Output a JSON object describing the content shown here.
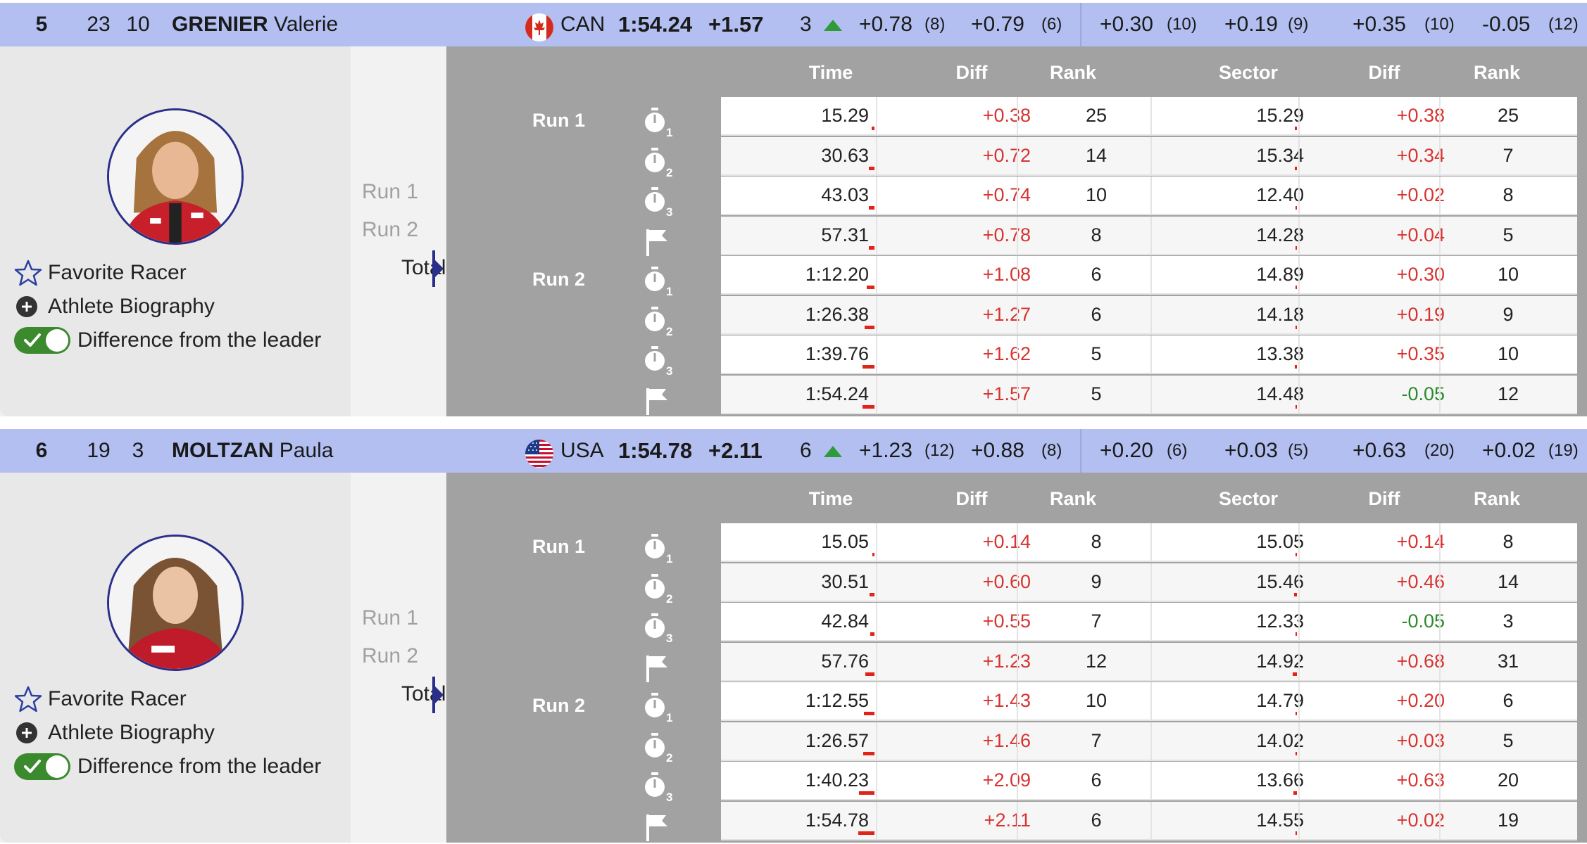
{
  "labels": {
    "favorite": "Favorite Racer",
    "biography": "Athlete Biography",
    "diff_leader": "Difference from the leader",
    "run1": "Run 1",
    "run2": "Run 2",
    "total": "Total",
    "col_time": "Time",
    "col_diff": "Diff",
    "col_rank": "Rank",
    "col_sector": "Sector",
    "col_diff2": "Diff",
    "col_rank2": "Rank"
  },
  "colors": {
    "header_bg": "#b2bff0",
    "accent": "#2a2f8a",
    "negative": "#d7332f",
    "positive": "#2b8a2b",
    "toggle_on": "#3c8a2e"
  },
  "racers": [
    {
      "pos": "5",
      "bib": "23",
      "start": "10",
      "last_name": "GRENIER",
      "first_name": "Valerie",
      "nation": "CAN",
      "flag": "canada-flag-icon",
      "time": "1:54.24",
      "diff": "+1.57",
      "rank_change": "3",
      "splits": [
        {
          "v": "+0.78",
          "p": "(8)"
        },
        {
          "v": "+0.79",
          "p": "(6)"
        },
        {
          "v": "+0.30",
          "p": "(10)"
        },
        {
          "v": "+0.19",
          "p": "(9)"
        },
        {
          "v": "+0.35",
          "p": "(10)"
        },
        {
          "v": "-0.05",
          "p": "(12)"
        }
      ],
      "rows": [
        {
          "time": "15.29",
          "diff": "+0.38",
          "rank": "25",
          "sector": "15.29",
          "sdiff": "+0.38",
          "srank": "25",
          "bar": 0.07,
          "sbar": 0.05
        },
        {
          "time": "30.63",
          "diff": "+0.72",
          "rank": "14",
          "sector": "15.34",
          "sdiff": "+0.34",
          "srank": "7",
          "bar": 0.13,
          "sbar": 0.05
        },
        {
          "time": "43.03",
          "diff": "+0.74",
          "rank": "10",
          "sector": "12.40",
          "sdiff": "+0.02",
          "srank": "8",
          "bar": 0.13,
          "sbar": 0.01
        },
        {
          "time": "57.31",
          "diff": "+0.78",
          "rank": "8",
          "sector": "14.28",
          "sdiff": "+0.04",
          "srank": "5",
          "bar": 0.14,
          "sbar": 0.01
        },
        {
          "time": "1:12.20",
          "diff": "+1.08",
          "rank": "6",
          "sector": "14.89",
          "sdiff": "+0.30",
          "srank": "10",
          "bar": 0.19,
          "sbar": 0.04
        },
        {
          "time": "1:26.38",
          "diff": "+1.27",
          "rank": "6",
          "sector": "14.18",
          "sdiff": "+0.19",
          "srank": "9",
          "bar": 0.23,
          "sbar": 0.03
        },
        {
          "time": "1:39.76",
          "diff": "+1.62",
          "rank": "5",
          "sector": "13.38",
          "sdiff": "+0.35",
          "srank": "10",
          "bar": 0.29,
          "sbar": 0.05
        },
        {
          "time": "1:54.24",
          "diff": "+1.57",
          "rank": "5",
          "sector": "14.48",
          "sdiff": "-0.05",
          "srank": "12",
          "bar": 0.28,
          "sbar": 0.01,
          "sgreen": true
        }
      ]
    },
    {
      "pos": "6",
      "bib": "19",
      "start": "3",
      "last_name": "MOLTZAN",
      "first_name": "Paula",
      "nation": "USA",
      "flag": "usa-flag-icon",
      "time": "1:54.78",
      "diff": "+2.11",
      "rank_change": "6",
      "splits": [
        {
          "v": "+1.23",
          "p": "(12)"
        },
        {
          "v": "+0.88",
          "p": "(8)"
        },
        {
          "v": "+0.20",
          "p": "(6)"
        },
        {
          "v": "+0.03",
          "p": "(5)"
        },
        {
          "v": "+0.63",
          "p": "(20)"
        },
        {
          "v": "+0.02",
          "p": "(19)"
        }
      ],
      "rows": [
        {
          "time": "15.05",
          "diff": "+0.14",
          "rank": "8",
          "sector": "15.05",
          "sdiff": "+0.14",
          "srank": "8",
          "bar": 0.03,
          "sbar": 0.02
        },
        {
          "time": "30.51",
          "diff": "+0.60",
          "rank": "9",
          "sector": "15.46",
          "sdiff": "+0.46",
          "srank": "14",
          "bar": 0.11,
          "sbar": 0.07
        },
        {
          "time": "42.84",
          "diff": "+0.55",
          "rank": "7",
          "sector": "12.33",
          "sdiff": "-0.05",
          "srank": "3",
          "bar": 0.1,
          "sbar": 0.01,
          "sgreen": true
        },
        {
          "time": "57.76",
          "diff": "+1.23",
          "rank": "12",
          "sector": "14.92",
          "sdiff": "+0.68",
          "srank": "31",
          "bar": 0.22,
          "sbar": 0.1
        },
        {
          "time": "1:12.55",
          "diff": "+1.43",
          "rank": "10",
          "sector": "14.79",
          "sdiff": "+0.20",
          "srank": "6",
          "bar": 0.25,
          "sbar": 0.03
        },
        {
          "time": "1:26.57",
          "diff": "+1.46",
          "rank": "7",
          "sector": "14.02",
          "sdiff": "+0.03",
          "srank": "5",
          "bar": 0.26,
          "sbar": 0.01
        },
        {
          "time": "1:40.23",
          "diff": "+2.09",
          "rank": "6",
          "sector": "13.66",
          "sdiff": "+0.63",
          "srank": "20",
          "bar": 0.37,
          "sbar": 0.09
        },
        {
          "time": "1:54.78",
          "diff": "+2.11",
          "rank": "6",
          "sector": "14.55",
          "sdiff": "+0.02",
          "srank": "19",
          "bar": 0.38,
          "sbar": 0.01
        }
      ]
    }
  ]
}
